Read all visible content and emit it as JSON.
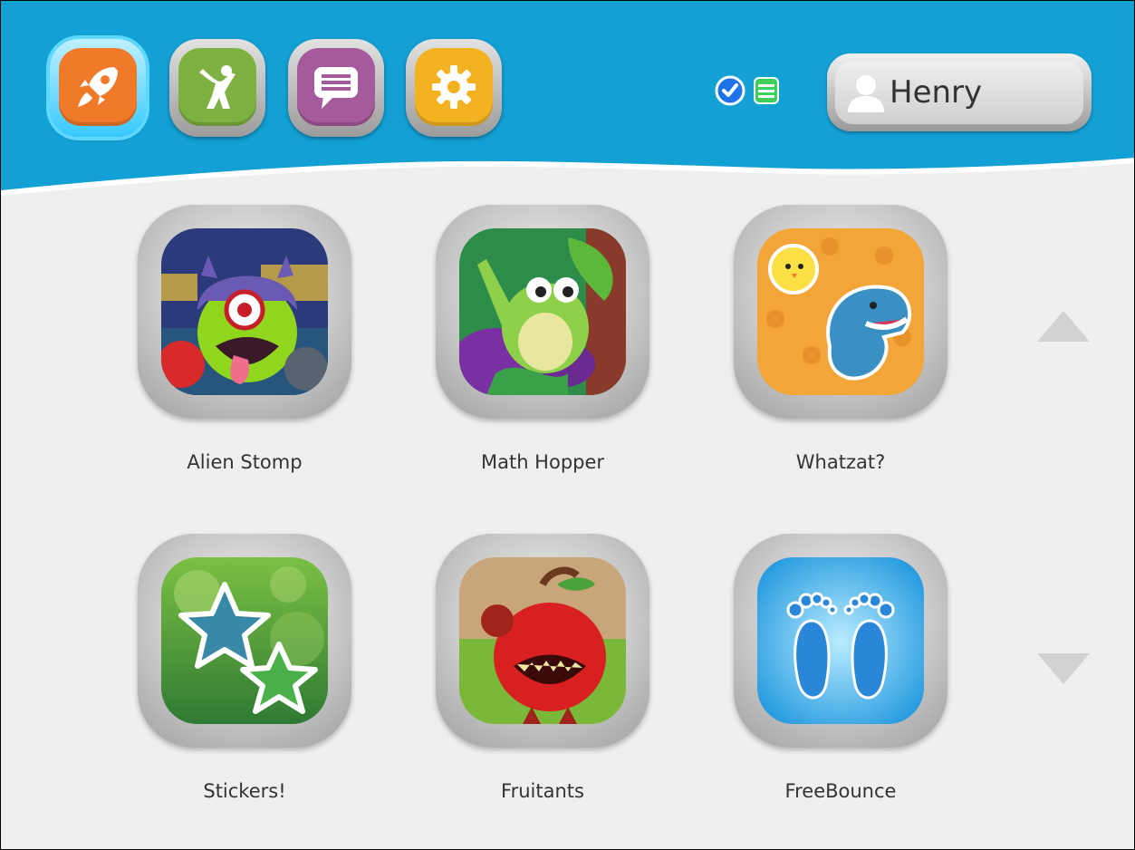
{
  "nav": {
    "buttons": [
      {
        "name": "rocket-icon",
        "color": "#f07a2a",
        "active": true
      },
      {
        "name": "person-jumping-icon",
        "color": "#7fb042",
        "active": false
      },
      {
        "name": "chat-bubble-icon",
        "color": "#a55a9b",
        "active": false
      },
      {
        "name": "gear-icon",
        "color": "#f3b321",
        "active": false
      }
    ]
  },
  "status": {
    "check_icon": "check-circle-icon",
    "list_icon": "list-icon",
    "check_color": "#1e73e8",
    "list_color": "#3fcf5a"
  },
  "user": {
    "name": "Henry",
    "avatar_icon": "person-silhouette-icon"
  },
  "apps": [
    {
      "label": "Alien Stomp",
      "art": "alien-monster-art"
    },
    {
      "label": "Math Hopper",
      "art": "frog-art"
    },
    {
      "label": "Whatzat?",
      "art": "chick-dinosaur-art"
    },
    {
      "label": "Stickers!",
      "art": "stars-art"
    },
    {
      "label": "Fruitants",
      "art": "angry-apple-art"
    },
    {
      "label": "FreeBounce",
      "art": "footprints-art"
    }
  ],
  "scroll": {
    "up_icon": "triangle-up-icon",
    "down_icon": "triangle-down-icon"
  },
  "colors": {
    "header_blue": "#13a0d4",
    "background": "#efefef"
  }
}
